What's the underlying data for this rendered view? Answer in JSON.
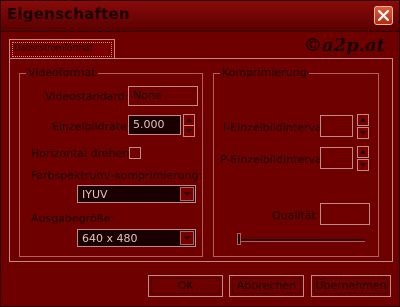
{
  "window": {
    "title": "Eigenschaften",
    "logo_text": "©a2p.at"
  },
  "tab": {
    "label": "Datenstromformat"
  },
  "video_group": {
    "title": "Videoformat",
    "videostandard_label": "Videostandard:",
    "videostandard_value": "None",
    "framerate_label": "Einzelbildrate:",
    "framerate_value": "5.000",
    "flip_label": "Horizontal drehen:",
    "color_label": "Farbspektrum/-komprimierung:",
    "color_value": "IYUV",
    "size_label": "Ausgabegröße:",
    "size_value": "640 x 480"
  },
  "compression_group": {
    "title": "Komprimierung",
    "i_frame_label": "I-Einzelbildintervall:",
    "p_frame_label": "P-Einzelbildintervall:",
    "quality_label": "Qualität:",
    "quality_slider_value": 0
  },
  "buttons": {
    "ok": "OK",
    "cancel": "Abbrechen",
    "apply": "Übernehmen"
  },
  "colors": {
    "background": "#6e0000",
    "text": "#1a0000",
    "border": "#c08a8a"
  }
}
